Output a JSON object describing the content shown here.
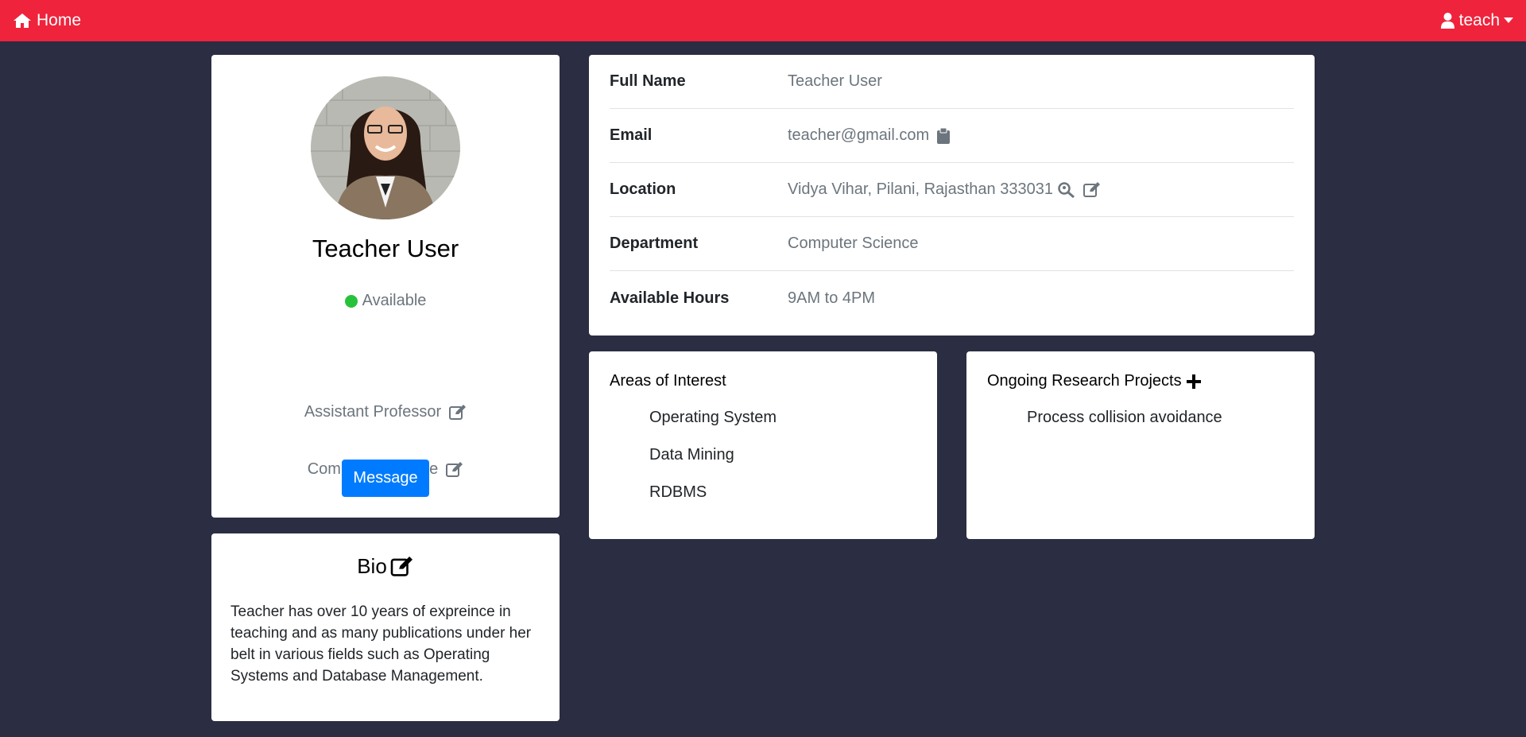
{
  "nav": {
    "home_label": "Home",
    "user_label": "teach"
  },
  "profile": {
    "name": "Teacher User",
    "status": "Available",
    "title": "Assistant Professor",
    "department": "Computer Science",
    "message_button": "Message"
  },
  "bio": {
    "heading": "Bio",
    "text": "Teacher has over 10 years of expreince in teaching and as many publications under her belt in various fields such as Operating Systems and Database Management."
  },
  "details": {
    "rows": [
      {
        "label": "Full Name",
        "value": "Teacher User"
      },
      {
        "label": "Email",
        "value": "teacher@gmail.com"
      },
      {
        "label": "Location",
        "value": "Vidya Vihar, Pilani, Rajasthan 333031"
      },
      {
        "label": "Department",
        "value": "Computer Science"
      },
      {
        "label": "Available Hours",
        "value": "9AM to 4PM"
      }
    ]
  },
  "interests": {
    "title": "Areas of Interest",
    "items": [
      "Operating System",
      "Data Mining",
      "RDBMS"
    ]
  },
  "projects": {
    "title": "Ongoing Research Projects",
    "items": [
      "Process collision avoidance"
    ]
  },
  "icons": {
    "home": "home-icon",
    "user": "user-icon",
    "caret": "caret-down-icon",
    "edit": "edit-icon",
    "clipboard": "clipboard-icon",
    "search_location": "search-location-icon",
    "plus": "plus-icon"
  },
  "colors": {
    "navbar": "#ef233c",
    "background": "#2b2d42",
    "primary_button": "#007bff",
    "status_available": "#28c23a"
  }
}
